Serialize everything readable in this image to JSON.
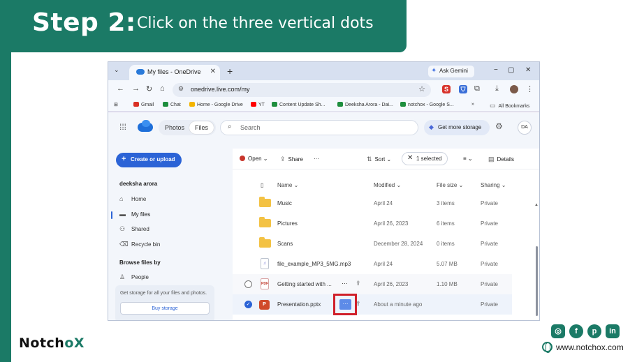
{
  "tutorial": {
    "step_title": "Step 2:",
    "step_description": "Click on the three vertical dots",
    "brand_name": "Notch",
    "brand_accent": "oX",
    "website": "www.notchox.com",
    "brand_color": "#1b7a66",
    "highlight_color": "#d0202a",
    "social_icons": [
      "instagram-icon",
      "facebook-icon",
      "pinterest-icon",
      "linkedin-icon"
    ]
  },
  "browser": {
    "tab_title": "My files - OneDrive",
    "new_tab": "+",
    "ask_gemini": "Ask Gemini",
    "url": "onedrive.live.com/my",
    "window_controls": [
      "−",
      "▢",
      "✕"
    ],
    "bookmarks": [
      {
        "label": "Gmail",
        "color": "#d93025"
      },
      {
        "label": "Chat",
        "color": "#1e8e3e"
      },
      {
        "label": "Home - Google Drive",
        "color": "#f4b400"
      },
      {
        "label": "YT",
        "color": "#ff0000"
      },
      {
        "label": "Content Update Sh...",
        "color": "#1e8e3e"
      },
      {
        "label": "Deeksha Arora - Dai...",
        "color": "#1e8e3e"
      },
      {
        "label": "notchox - Google S...",
        "color": "#1e8e3e"
      }
    ],
    "bookmarks_overflow": "»",
    "all_bookmarks": "All Bookmarks"
  },
  "onedrive": {
    "tabs": [
      {
        "label": "Photos"
      },
      {
        "label": "Files"
      }
    ],
    "search_placeholder": "Search",
    "storage_button": "Get more storage",
    "avatar_initials": "DA",
    "create_button": "Create or upload",
    "user_name": "deeksha arora",
    "nav": [
      {
        "label": "Home",
        "icon": "home-icon"
      },
      {
        "label": "My files",
        "icon": "folder-icon"
      },
      {
        "label": "Shared",
        "icon": "people-icon"
      },
      {
        "label": "Recycle bin",
        "icon": "trash-icon"
      }
    ],
    "browse_heading": "Browse files by",
    "browse_items": [
      {
        "label": "People"
      }
    ],
    "storage_note": "Get storage for all your files and photos.",
    "buy_storage": "Buy storage",
    "commands": {
      "open": "Open",
      "share": "Share",
      "more": "···",
      "sort": "Sort",
      "selected": "1 selected",
      "details": "Details"
    },
    "columns": [
      "Name",
      "Modified",
      "File size",
      "Sharing"
    ],
    "files": [
      {
        "name": "Music",
        "modified": "April 24",
        "size": "3 items",
        "sharing": "Private",
        "type": "folder"
      },
      {
        "name": "Pictures",
        "modified": "April 26, 2023",
        "size": "6 items",
        "sharing": "Private",
        "type": "folder"
      },
      {
        "name": "Scans",
        "modified": "December 28, 2024",
        "size": "0 items",
        "sharing": "Private",
        "type": "folder"
      },
      {
        "name": "file_example_MP3_5MG.mp3",
        "modified": "April 24",
        "size": "5.07 MB",
        "sharing": "Private",
        "type": "audio"
      },
      {
        "name": "Getting started with ...",
        "modified": "April 26, 2023",
        "size": "1.10 MB",
        "sharing": "Private",
        "type": "pdf"
      },
      {
        "name": "Presentation.pptx",
        "modified": "About a minute ago",
        "size": "",
        "sharing": "Private",
        "type": "pptx",
        "selected": true
      }
    ],
    "row_more": "···"
  }
}
